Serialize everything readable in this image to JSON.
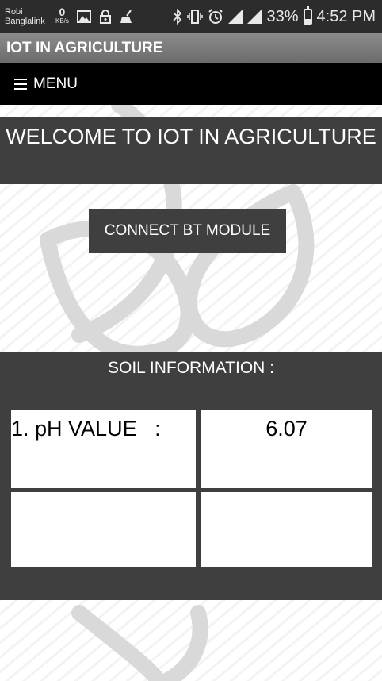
{
  "status_bar": {
    "carrier_line1": "Robi",
    "carrier_line2": "Banglalink",
    "net_speed": "0",
    "net_unit": "KB/s",
    "battery": "33%",
    "battery_level": 0.33,
    "time": "4:52 PM",
    "icons": [
      "image-icon",
      "lock-icon",
      "broom-icon",
      "bluetooth-icon",
      "vibrate-icon",
      "alarm-icon",
      "signal-icon",
      "signal-icon",
      "battery-icon"
    ]
  },
  "app": {
    "title": "IOT IN AGRICULTURE"
  },
  "menu": {
    "label": "MENU"
  },
  "welcome": {
    "text": "WELCOME TO IOT IN AGRICULTURE"
  },
  "connect_button": {
    "label": "CONNECT BT MODULE"
  },
  "soil": {
    "title": "SOIL INFORMATION :",
    "rows": [
      {
        "label": "1. pH VALUE   :",
        "value": "6.07"
      },
      {
        "label": "",
        "value": ""
      }
    ]
  },
  "colors": {
    "panel": "#3f3f3f",
    "menubar": "#000000",
    "statusbar": "#2c2c2c"
  }
}
